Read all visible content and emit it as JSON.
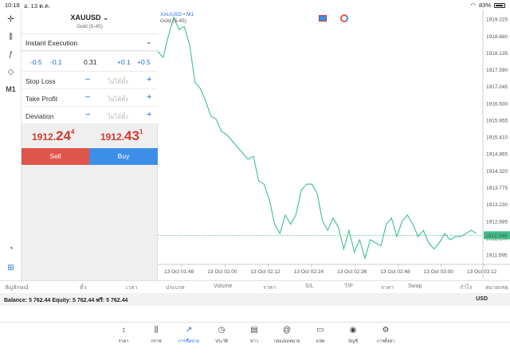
{
  "status_bar": {
    "time": "10:18",
    "date": "อ. 13 ต.ค.",
    "battery": "83%"
  },
  "order_panel": {
    "symbol": "XAUUSD",
    "description": "Gold (5-45)",
    "execution": "Instant Execution",
    "volume_steps": [
      "-0.5",
      "-0.1",
      "0.31",
      "+0.1",
      "+0.5"
    ],
    "rows": [
      {
        "label": "Stop Loss",
        "placeholder": "ไม่ได้ตั้ง"
      },
      {
        "label": "Take Profit",
        "placeholder": "ไม่ได้ตั้ง"
      },
      {
        "label": "Deviation",
        "placeholder": "ไม่ได้ตั้ง"
      }
    ],
    "minus_label": "−",
    "plus_label": "+",
    "bid": {
      "pre": "1912.",
      "big": "24",
      "sup": "4"
    },
    "ask": {
      "pre": "1912.",
      "big": "43",
      "sup": "1"
    },
    "sell_label": "Sell",
    "buy_label": "Buy"
  },
  "chart_header": {
    "symbol": "XAUUSD • M1",
    "description": "Gold (5-45)"
  },
  "chart_data": {
    "type": "line",
    "x_labels": [
      "13 Oct 01:48",
      "13 Oct 02:00",
      "13 Oct 02:12",
      "13 Oct 02:24",
      "13 Oct 02:36",
      "13 Oct 02:48",
      "13 Oct 03:00",
      "13 Oct 03:12"
    ],
    "y_ticks": [
      "1919.225",
      "1918.680",
      "1918.135",
      "1917.590",
      "1917.045",
      "1916.500",
      "1915.955",
      "1915.410",
      "1914.865",
      "1914.320",
      "1913.775",
      "1913.230",
      "1912.685",
      "1912.140",
      "1911.595"
    ],
    "ylim": [
      1911.3,
      1919.5
    ],
    "current_price": 1912.244,
    "current_label": "1912.244",
    "values": [
      1918.2,
      1918.0,
      1918.7,
      1919.3,
      1918.9,
      1919.0,
      1918.4,
      1917.2,
      1917.0,
      1916.6,
      1916.1,
      1916.0,
      1915.6,
      1915.5,
      1915.3,
      1915.1,
      1914.9,
      1914.7,
      1914.8,
      1914.0,
      1913.9,
      1913.4,
      1912.6,
      1912.3,
      1912.9,
      1912.6,
      1912.9,
      1913.7,
      1913.9,
      1913.9,
      1913.6,
      1912.7,
      1912.4,
      1912.8,
      1912.5,
      1911.8,
      1912.4,
      1911.7,
      1912.1,
      1911.5,
      1912.1,
      1912.0,
      1911.9,
      1912.6,
      1912.8,
      1912.2,
      1912.7,
      1912.9,
      1912.6,
      1912.2,
      1912.4,
      1912.0,
      1911.8,
      1912.0,
      1912.3,
      1912.1,
      1912.2,
      1912.2,
      1912.3,
      1912.4,
      1912.3
    ],
    "line_color": "#3fbf8a"
  },
  "terminal_columns": [
    "สัญลักษณ์",
    "ตั๋ว",
    "เวลา",
    "ประเภท",
    "Volume",
    "ราคา",
    "S/L",
    "T/P",
    "ราคา",
    "Swap",
    "กำไร",
    "หมายเหตุ"
  ],
  "balance_text": "Balance: 5 762.44 Equity: 5 762.44 ฟรี: 5 762.44",
  "currency": "USD",
  "tabs": [
    {
      "label": "ราคา",
      "icon": "↕"
    },
    {
      "label": "กราฟ",
      "icon": "⫼"
    },
    {
      "label": "การซื้อขาย",
      "icon": "↗"
    },
    {
      "label": "ประวัติ",
      "icon": "◷"
    },
    {
      "label": "ข่าว",
      "icon": "▤"
    },
    {
      "label": "กล่องจดหมาย",
      "icon": "@"
    },
    {
      "label": "แชท",
      "icon": "▭"
    },
    {
      "label": "บัญชี",
      "icon": "◉"
    },
    {
      "label": "การตั้งค่า",
      "icon": "⚙"
    }
  ]
}
